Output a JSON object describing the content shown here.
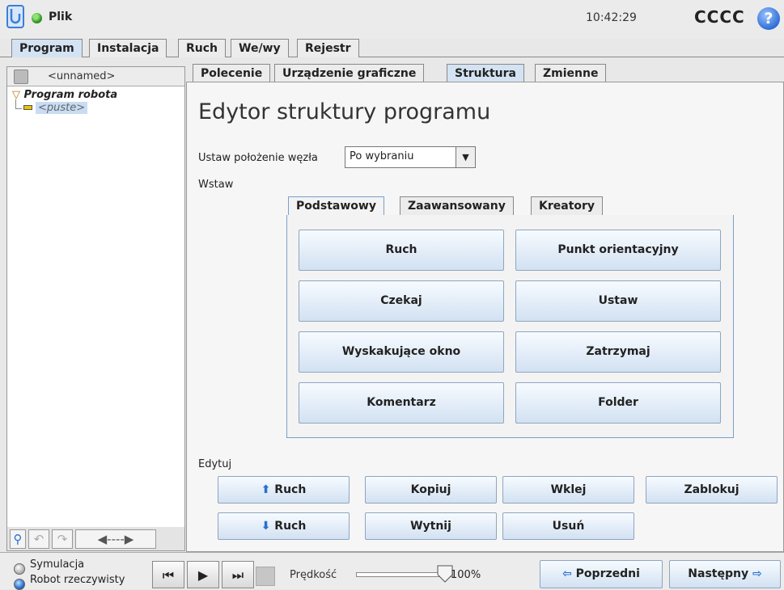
{
  "header": {
    "file_label": "Plik",
    "time": "10:42:29",
    "user": "CCCC",
    "help": "?"
  },
  "main_tabs": [
    "Program",
    "Instalacja",
    "Ruch",
    "We/wy",
    "Rejestr"
  ],
  "program_tabs": [
    "Polecenie",
    "Urządzenie graficzne",
    "Struktura",
    "Zmienne"
  ],
  "left": {
    "program_name": "<unnamed>",
    "tree_root": "Program robota",
    "tree_empty": "<puste>"
  },
  "editor": {
    "title": "Edytor struktury programu",
    "place_label": "Ustaw położenie węzła",
    "place_value": "Po wybraniu",
    "insert_label": "Wstaw",
    "insert_tabs": [
      "Podstawowy",
      "Zaawansowany",
      "Kreatory"
    ],
    "insert_buttons": [
      "Ruch",
      "Punkt orientacyjny",
      "Czekaj",
      "Ustaw",
      "Wyskakujące okno",
      "Zatrzymaj",
      "Komentarz",
      "Folder"
    ],
    "edit_label": "Edytuj",
    "edit_buttons": {
      "move_up": "Ruch",
      "copy": "Kopiuj",
      "paste": "Wklej",
      "lock": "Zablokuj",
      "move_down": "Ruch",
      "cut": "Wytnij",
      "delete": "Usuń"
    }
  },
  "footer": {
    "simulation": "Symulacja",
    "real_robot": "Robot rzeczywisty",
    "speed_label": "Prędkość",
    "speed_value": "100%",
    "speed_fraction": 1.0,
    "prev": "Poprzedni",
    "next": "Następny"
  }
}
